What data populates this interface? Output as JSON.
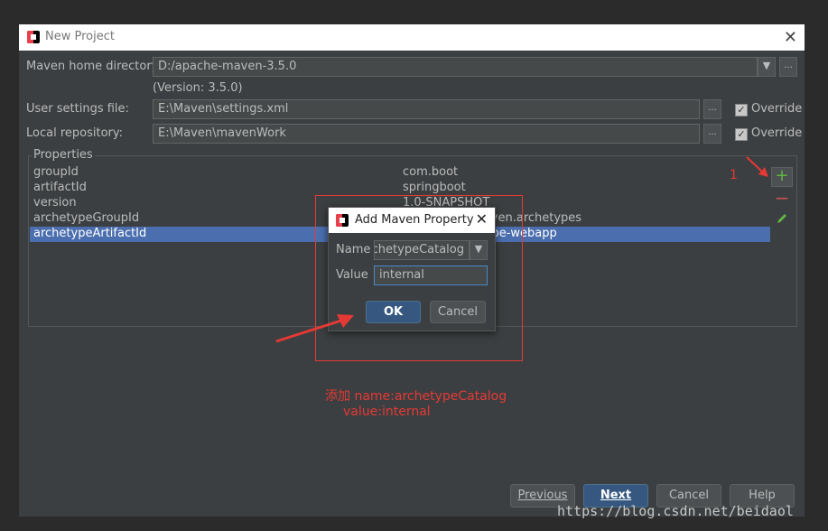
{
  "window": {
    "title": "New Project",
    "close_icon": "close-icon"
  },
  "maven": {
    "home_label": "Maven home directory:",
    "home_value": "D:/apache-maven-3.5.0",
    "version_text": "(Version: 3.5.0)",
    "settings_label": "User settings file:",
    "settings_value": "E:\\Maven\\settings.xml",
    "repo_label": "Local repository:",
    "repo_value": "E:\\Maven\\mavenWork",
    "override_label": "Override",
    "browse_label": "...",
    "dropdown_arrow": "▼"
  },
  "properties": {
    "label": "Properties",
    "rows": [
      {
        "key": "groupId",
        "value": "com.boot"
      },
      {
        "key": "artifactId",
        "value": "springboot"
      },
      {
        "key": "version",
        "value": "1.0-SNAPSHOT"
      },
      {
        "key": "archetypeGroupId",
        "value": "org.apache.maven.archetypes"
      },
      {
        "key": "archetypeArtifactId",
        "value": "maven-archetype-webapp"
      }
    ],
    "selected_index": 4,
    "add_symbol": "+",
    "remove_symbol": "−"
  },
  "dialog": {
    "title": "Add Maven Property",
    "name_label": "Name",
    "name_value": "archetypeCatalog",
    "value_label": "Value",
    "value_value": "internal",
    "ok_label": "OK",
    "cancel_label": "Cancel"
  },
  "buttons": {
    "previous": "Previous",
    "next": "Next",
    "cancel": "Cancel",
    "help": "Help"
  },
  "annotations": {
    "step_number": "1",
    "line1": "添加 name:archetypeCatalog",
    "line2": "value:internal",
    "color": "#e53935"
  },
  "watermark": "https://blog.csdn.net/beidaol"
}
